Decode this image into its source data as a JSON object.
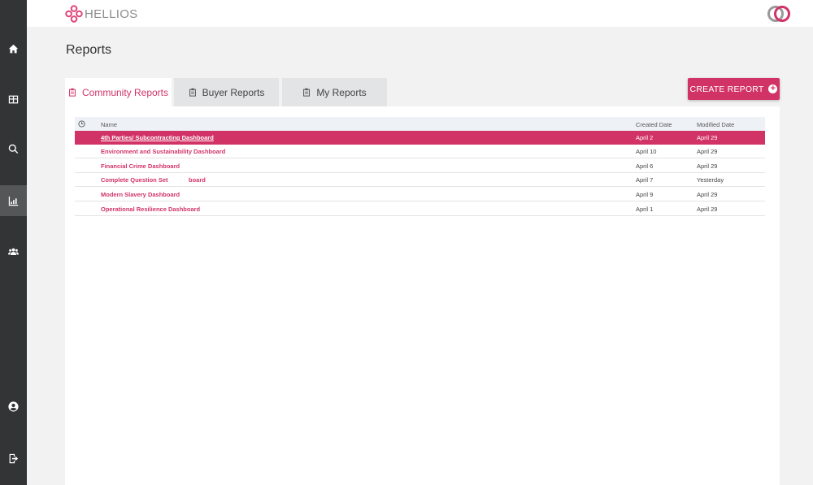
{
  "app": {
    "logo_text": "HELLIOS"
  },
  "sidebar": {
    "items": [
      {
        "icon": "home-icon"
      },
      {
        "icon": "table-icon"
      },
      {
        "icon": "search-icon"
      },
      {
        "icon": "chart-icon",
        "active": true
      },
      {
        "icon": "users-icon"
      },
      {
        "icon": "account-icon"
      },
      {
        "icon": "logout-icon"
      }
    ]
  },
  "page": {
    "title": "Reports"
  },
  "tabs": [
    {
      "label": "Community Reports",
      "active": true
    },
    {
      "label": "Buyer Reports"
    },
    {
      "label": "My Reports"
    }
  ],
  "create_button": {
    "label": "CREATE REPORT"
  },
  "table": {
    "columns": [
      "Name",
      "Created Date",
      "Modified Date"
    ],
    "rows": [
      {
        "name": "4th Parties/ Subcontracting Dashboard",
        "created": "April 2",
        "modified": "April 29",
        "selected": true
      },
      {
        "name": "Environment and Sustainability Dashboard",
        "created": "April 10",
        "modified": "April 29"
      },
      {
        "name": "Financial Crime Dashboard",
        "created": "April 6",
        "modified": "April 29"
      },
      {
        "name": "Complete Question Set",
        "name_tail": "board",
        "created": "April 7",
        "modified": "Yesterday"
      },
      {
        "name": "Modern Slavery Dashboard",
        "created": "April 9",
        "modified": "April 29"
      },
      {
        "name": "Operational Resilience Dashboard",
        "created": "April 1",
        "modified": "April 29"
      }
    ]
  },
  "colors": {
    "accent": "#d23367",
    "sidebar": "#333436",
    "sidebar_active": "#555658",
    "tab_inactive": "#e3e4e6"
  }
}
